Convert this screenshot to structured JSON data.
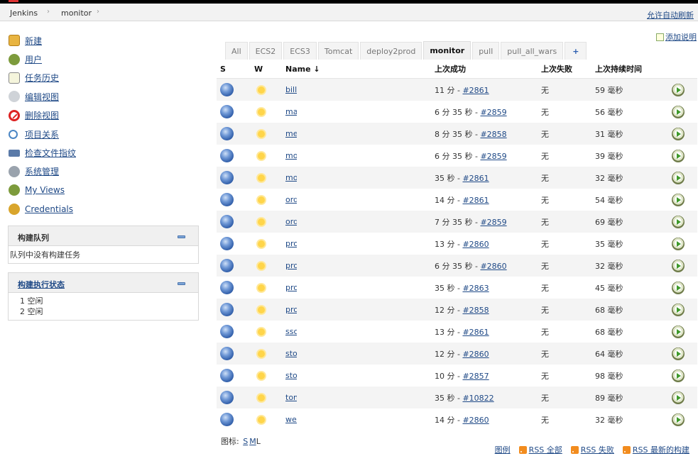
{
  "breadcrumbs": [
    "Jenkins",
    "monitor"
  ],
  "header": {
    "auto_refresh": "允许自动刷新"
  },
  "add_description": "添加说明",
  "sidebar": {
    "tasks": [
      {
        "label": "新建",
        "icon": "new-item-icon"
      },
      {
        "label": "用户",
        "icon": "people-icon"
      },
      {
        "label": "任务历史",
        "icon": "history-icon"
      },
      {
        "label": "编辑视图",
        "icon": "gear-icon"
      },
      {
        "label": "删除视图",
        "icon": "delete-icon"
      },
      {
        "label": "项目关系",
        "icon": "search-icon"
      },
      {
        "label": "检查文件指纹",
        "icon": "fingerprint-icon"
      },
      {
        "label": "系统管理",
        "icon": "gear-icon"
      },
      {
        "label": "My Views",
        "icon": "people-icon"
      },
      {
        "label": "Credentials",
        "icon": "credentials-icon"
      }
    ],
    "build_queue": {
      "title": "构建队列",
      "empty": "队列中没有构建任务"
    },
    "executors": {
      "title": "构建执行状态",
      "rows": [
        {
          "num": "1",
          "state": "空闲"
        },
        {
          "num": "2",
          "state": "空闲"
        }
      ]
    }
  },
  "tabs": [
    "All",
    "ECS2",
    "ECS3",
    "Tomcat",
    "deploy2prod",
    "monitor",
    "pull",
    "pull_all_wars",
    "+"
  ],
  "active_tab": "monitor",
  "table": {
    "headers": {
      "s": "S",
      "w": "W",
      "name": "Name ↓",
      "last_success": "上次成功",
      "last_failure": "上次失败",
      "last_duration": "上次持续时间"
    },
    "rows": [
      {
        "name": "bill-",
        "success_time": "11 分 - ",
        "success_build": "#2861",
        "failure": "无",
        "duration": "59 毫秒"
      },
      {
        "name": "ma",
        "success_time": "6 分 35 秒 - ",
        "success_build": "#2859",
        "failure": "无",
        "duration": "56 毫秒"
      },
      {
        "name": "me",
        "success_time": "8 分 35 秒 - ",
        "success_build": "#2858",
        "failure": "无",
        "duration": "31 毫秒"
      },
      {
        "name": "mo",
        "success_time": "6 分 35 秒 - ",
        "success_build": "#2859",
        "failure": "无",
        "duration": "39 毫秒"
      },
      {
        "name": "mo",
        "success_time": "35 秒 - ",
        "success_build": "#2861",
        "failure": "无",
        "duration": "32 毫秒"
      },
      {
        "name": "ord",
        "success_time": "14 分 - ",
        "success_build": "#2861",
        "failure": "无",
        "duration": "54 毫秒"
      },
      {
        "name": "ord",
        "success_time": "7 分 35 秒 - ",
        "success_build": "#2859",
        "failure": "无",
        "duration": "69 毫秒"
      },
      {
        "name": "pro",
        "success_time": "13 分 - ",
        "success_build": "#2860",
        "failure": "无",
        "duration": "35 毫秒"
      },
      {
        "name": "pro",
        "success_time": "6 分 35 秒 - ",
        "success_build": "#2860",
        "failure": "无",
        "duration": "32 毫秒"
      },
      {
        "name": "pro",
        "success_time": "35 秒 - ",
        "success_build": "#2863",
        "failure": "无",
        "duration": "45 毫秒"
      },
      {
        "name": "pro",
        "success_time": "12 分 - ",
        "success_build": "#2858",
        "failure": "无",
        "duration": "68 毫秒"
      },
      {
        "name": "ssc",
        "success_time": "13 分 - ",
        "success_build": "#2861",
        "failure": "无",
        "duration": "68 毫秒"
      },
      {
        "name": "sto",
        "success_time": "12 分 - ",
        "success_build": "#2860",
        "failure": "无",
        "duration": "64 毫秒"
      },
      {
        "name": "sto",
        "success_time": "10 分 - ",
        "success_build": "#2857",
        "failure": "无",
        "duration": "98 毫秒"
      },
      {
        "name": "tom",
        "success_time": "35 秒 - ",
        "success_build": "#10822",
        "failure": "无",
        "duration": "89 毫秒"
      },
      {
        "name": "wet",
        "success_time": "14 分 - ",
        "success_build": "#2860",
        "failure": "无",
        "duration": "32 毫秒"
      }
    ]
  },
  "icon_size": {
    "label": "图标:",
    "sizes": [
      "S",
      "M",
      "L"
    ]
  },
  "footer": {
    "legend": "图例",
    "rss_all": "RSS 全部",
    "rss_failed": "RSS 失败",
    "rss_latest": "RSS 最新的构建"
  },
  "colors": {
    "link": "#204a87",
    "stripe": "#f4f4f4",
    "pane_header": "#f0f0f0"
  }
}
